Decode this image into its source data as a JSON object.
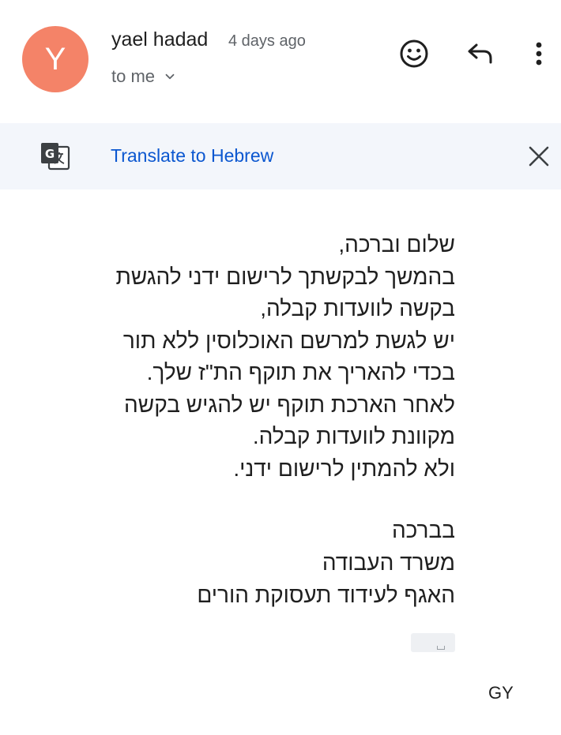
{
  "message": {
    "avatar_letter": "Y",
    "avatar_color": "#f48368",
    "sender_name": "yael hadad",
    "sent_time": "4 days ago",
    "recipient_label": "to me",
    "icons": {
      "emoji": "add-emoji-reaction-icon",
      "reply": "reply-icon",
      "more": "more-vertical-icon",
      "recipient_toggle": "chevron-down-icon"
    }
  },
  "translate_bar": {
    "icon": "google-translate-icon",
    "link_label": "Translate to Hebrew",
    "close_icon": "close-icon",
    "background": "#f3f6fb",
    "link_color": "#0b57d0"
  },
  "body": {
    "lines": [
      "שלום וברכה,",
      "בהמשך לבקשתך לרישום ידני להגשת",
      "בקשה לוועדות קבלה,",
      "יש לגשת למרשם האוכלוסין ללא תור",
      "בכדי להאריך את תוקף הת\"ז שלך.",
      "לאחר הארכת תוקף יש להגיש בקשה",
      "מקוונת לוועדות קבלה.",
      "ולא להמתין לרישום ידני."
    ],
    "signature": [
      "בברכה",
      "משרד העבודה",
      "האגף לעידוד תעסוקת הורים"
    ],
    "trimmed_content_icon": "show-trimmed-content-icon",
    "initials": "GY"
  }
}
